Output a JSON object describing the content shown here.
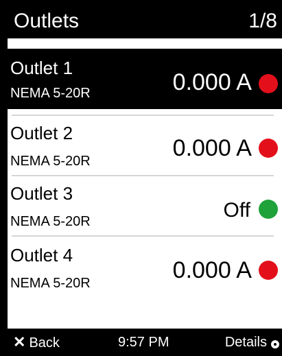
{
  "header": {
    "title": "Outlets",
    "page_indicator": "1/8"
  },
  "outlets": [
    {
      "name": "Outlet 1",
      "type": "NEMA 5-20R",
      "value": "0.000 A",
      "status_color": "#e3101b",
      "selected": true
    },
    {
      "name": "Outlet 2",
      "type": "NEMA 5-20R",
      "value": "0.000 A",
      "status_color": "#e3101b",
      "selected": false
    },
    {
      "name": "Outlet 3",
      "type": "NEMA 5-20R",
      "value": "Off",
      "status_color": "#1fa23a",
      "selected": false
    },
    {
      "name": "Outlet 4",
      "type": "NEMA 5-20R",
      "value": "0.000 A",
      "status_color": "#e3101b",
      "selected": false
    }
  ],
  "footer": {
    "back_icon": "x-icon",
    "back_label": "Back",
    "time": "9:57 PM",
    "details_label": "Details",
    "details_icon": "ring-icon"
  },
  "colors": {
    "background": "#000000",
    "selection": "#000000",
    "red": "#e3101b",
    "green": "#1fa23a"
  }
}
